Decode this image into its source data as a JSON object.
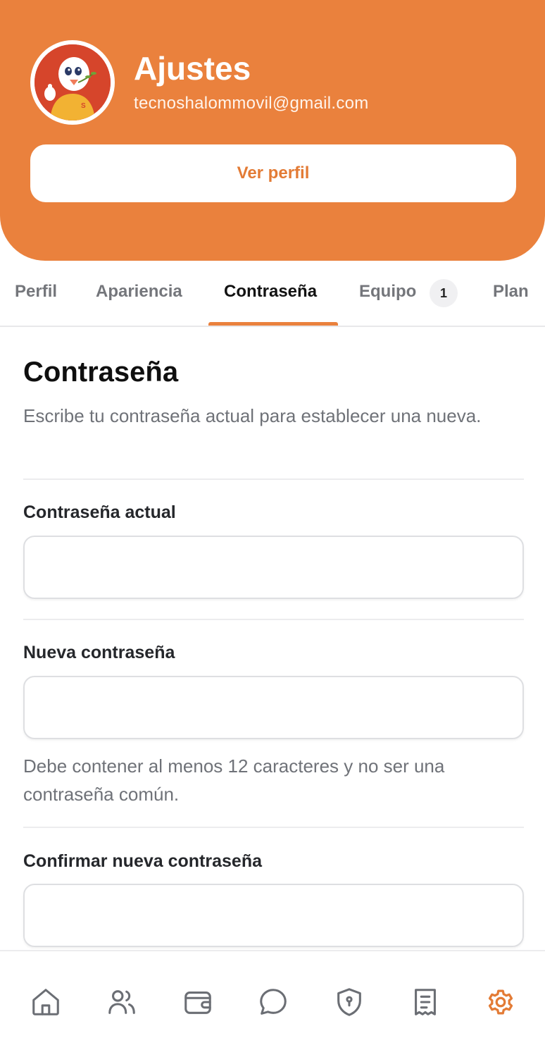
{
  "header": {
    "title": "Ajustes",
    "email": "tecnoshalommovil@gmail.com",
    "profile_button": "Ver perfil",
    "background_color": "#ea813d"
  },
  "tabs": [
    {
      "label": "Perfil",
      "active": false
    },
    {
      "label": "Apariencia",
      "active": false
    },
    {
      "label": "Contraseña",
      "active": true
    },
    {
      "label": "Equipo",
      "active": false,
      "badge": "1"
    },
    {
      "label": "Plan",
      "active": false
    }
  ],
  "section": {
    "title": "Contraseña",
    "description": "Escribe tu contraseña actual para establecer una nueva."
  },
  "fields": {
    "current": {
      "label": "Contraseña actual",
      "value": "",
      "placeholder": ""
    },
    "new": {
      "label": "Nueva contraseña",
      "value": "",
      "placeholder": "",
      "hint": "Debe contener al menos 12 caracteres y no ser una contraseña común."
    },
    "confirm": {
      "label": "Confirmar nueva contraseña",
      "value": "",
      "placeholder": ""
    }
  },
  "bottom_nav": {
    "items": [
      {
        "icon": "home-icon",
        "active": false
      },
      {
        "icon": "users-icon",
        "active": false
      },
      {
        "icon": "wallet-icon",
        "active": false
      },
      {
        "icon": "chat-icon",
        "active": false
      },
      {
        "icon": "shield-icon",
        "active": false
      },
      {
        "icon": "receipt-icon",
        "active": false
      },
      {
        "icon": "gear-icon",
        "active": true
      }
    ],
    "active_color": "#e37b35",
    "inactive_color": "#6b6e74"
  }
}
